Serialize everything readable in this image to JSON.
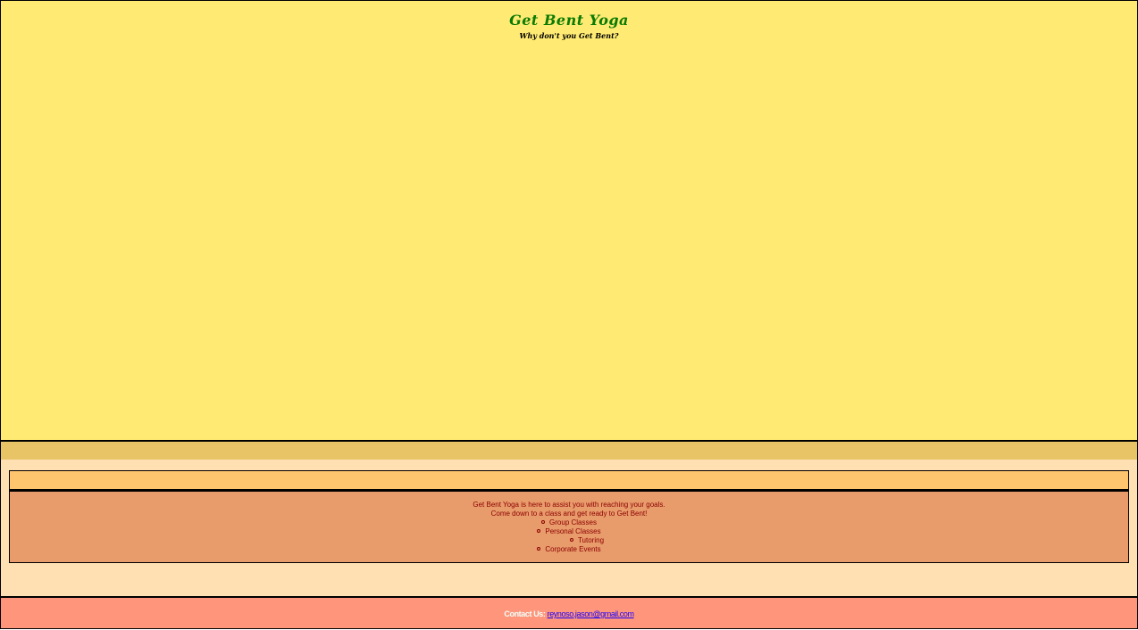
{
  "header": {
    "title": "Get Bent Yoga",
    "tagline": "Why don't you Get Bent?"
  },
  "main": {
    "intro_line1": "Get Bent Yoga is here to assist you with reaching your goals.",
    "intro_line2": "Come down to a class and get ready to Get Bent!",
    "services": [
      "Group Classes",
      "Personal Classes",
      "Tutoring",
      "Corporate Events"
    ]
  },
  "footer": {
    "contact_label": "Contact Us:",
    "contact_email": "reynoso.jason@gmail.com"
  },
  "colors": {
    "header_bg": "#ffeb73",
    "title": "#0a7a00",
    "nav_bg": "#e8c466",
    "main_bg": "#ffe0b2",
    "content_header_bg": "#ffc46e",
    "content_body_bg": "#e89b6b",
    "body_text": "#8b0000",
    "footer_bg": "#ff957a",
    "link": "#1a00ff"
  }
}
